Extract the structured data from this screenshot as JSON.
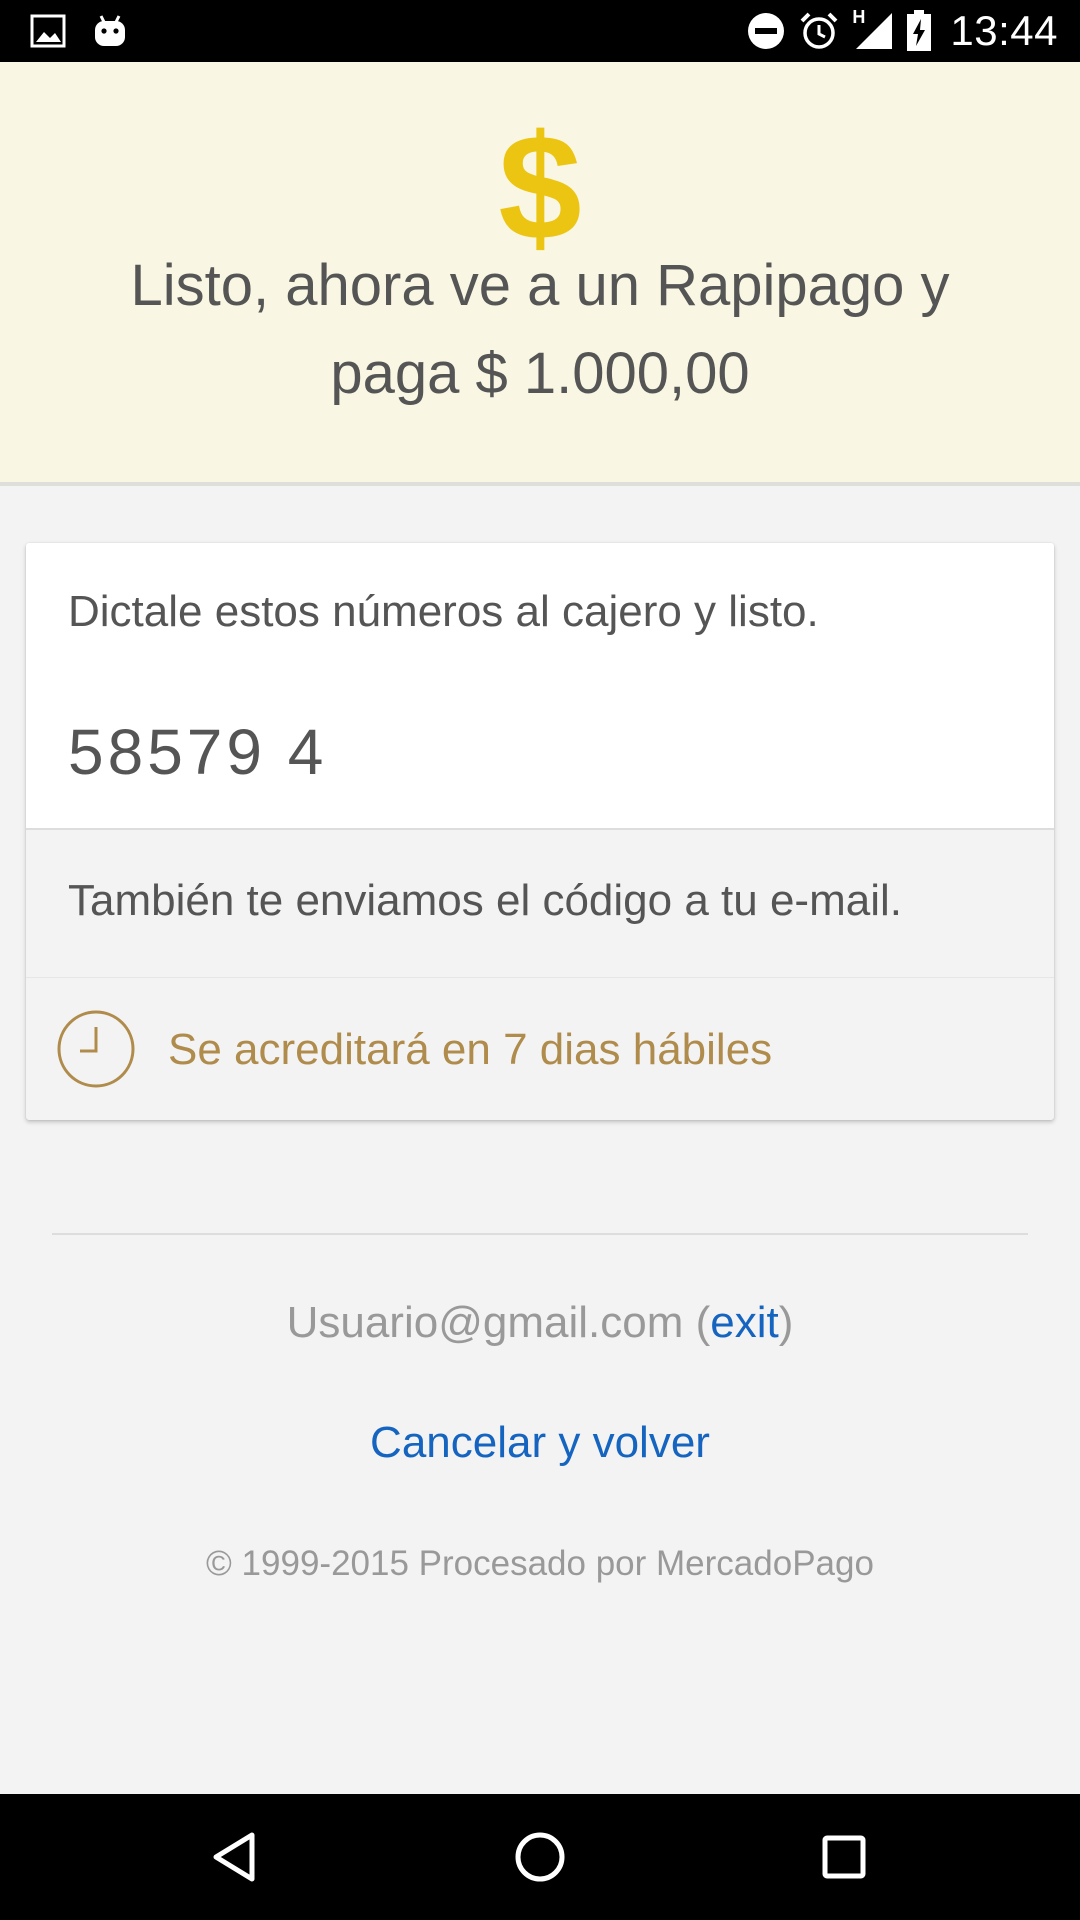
{
  "status_bar": {
    "time": "13:44",
    "network_label": "H",
    "icons": [
      "image-icon",
      "android-icon",
      "do-not-disturb-icon",
      "alarm-icon",
      "signal-icon",
      "battery-charging-icon"
    ]
  },
  "hero": {
    "icon_symbol": "$",
    "title": "Listo, ahora ve a un Rapipago y paga $ 1.000,00",
    "accent_color": "#ecc513"
  },
  "payment_card": {
    "instruction": "Dictale estos números al cajero y listo.",
    "code": "58579 4",
    "email_note": "También te enviamos el código a tu e-mail.",
    "accreditation_text": "Se acreditará en 7 dias hábiles",
    "accreditation_color": "#b08c4c"
  },
  "account": {
    "email": "Usuario@gmail.com",
    "open_paren": " (",
    "exit_label": "exit",
    "close_paren": ")"
  },
  "cancel_label": "Cancelar y volver",
  "footer": {
    "copyright": "© 1999-2015 Procesado por MercadoPago"
  },
  "nav_bar": {
    "buttons": [
      "back",
      "home",
      "recent-apps"
    ]
  },
  "colors": {
    "link": "#1565c0",
    "hero_background": "#f9f7e3"
  }
}
